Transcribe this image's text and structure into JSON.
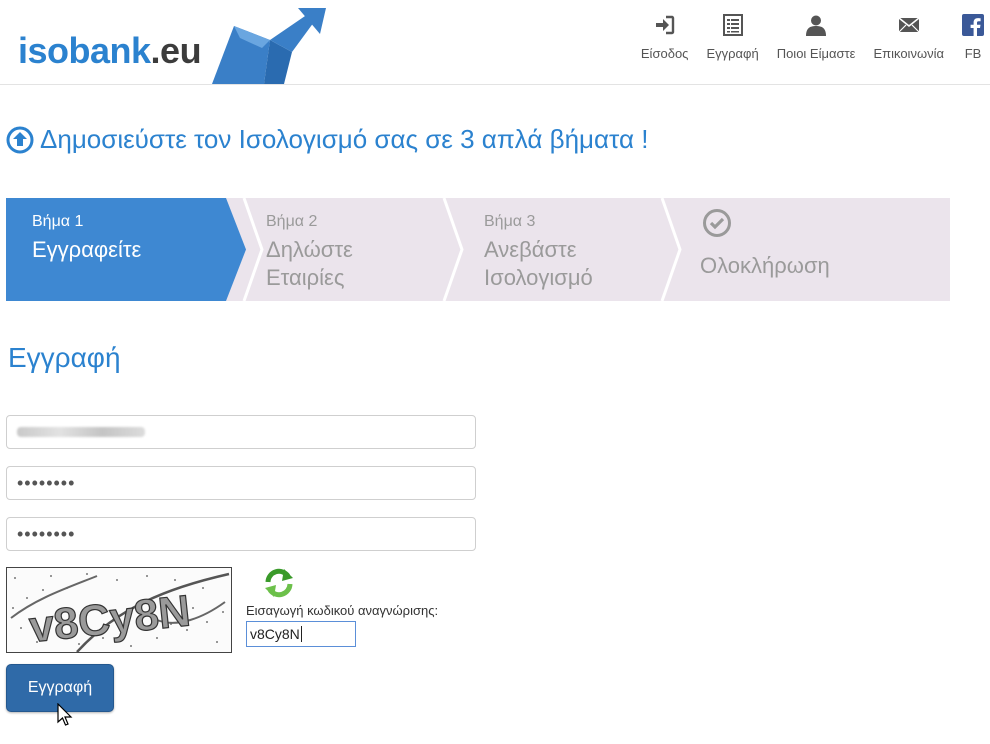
{
  "brand": {
    "name_main": "isobank",
    "name_suffix": ".eu",
    "colors": {
      "primary": "#2b82cf",
      "dark": "#3c3c3c",
      "step_bg": "#ebe4ec",
      "button": "#2f6aa8"
    }
  },
  "nav": {
    "items": [
      {
        "label": "Είσοδος",
        "icon": "login-icon"
      },
      {
        "label": "Εγγραφή",
        "icon": "list-icon"
      },
      {
        "label": "Ποιοι Είμαστε",
        "icon": "user-icon"
      },
      {
        "label": "Επικοινωνία",
        "icon": "envelope-icon"
      },
      {
        "label": "FB",
        "icon": "facebook-icon"
      }
    ]
  },
  "headline": "Δημοσιεύστε τον Ισολογισμό σας σε 3 απλά βήματα !",
  "steps": [
    {
      "small": "Βήμα 1",
      "line1": "Εγγραφείτε",
      "line2": ""
    },
    {
      "small": "Βήμα 2",
      "line1": "Δηλώστε",
      "line2": "Εταιρίες"
    },
    {
      "small": "Βήμα 3",
      "line1": "Ανεβάστε",
      "line2": "Ισολογισμό"
    },
    {
      "small": "",
      "line1": "Ολοκλήρωση",
      "line2": ""
    }
  ],
  "form": {
    "title": "Εγγραφή",
    "password_mask": "••••••••",
    "password_confirm_mask": "••••••••",
    "captcha_text": "v8Cy8N",
    "captcha_label": "Εισαγωγή κωδικού αναγνώρισης:",
    "captcha_value": "v8Cy8N",
    "submit_label": "Εγγραφή"
  }
}
